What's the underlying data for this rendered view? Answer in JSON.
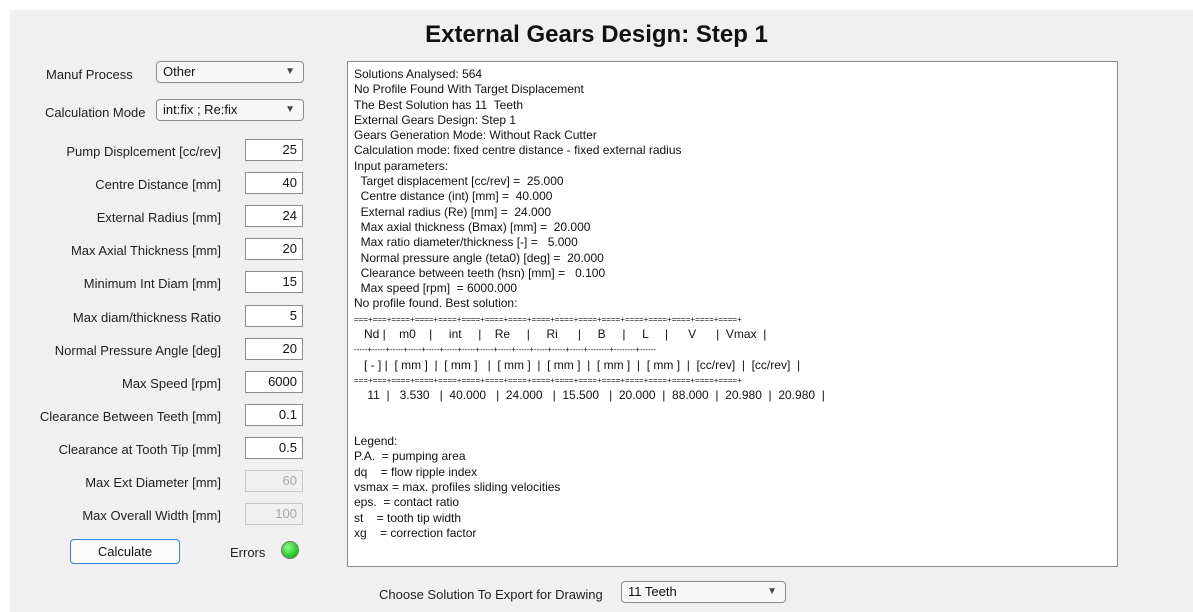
{
  "title": "External Gears Design: Step 1",
  "inputs": {
    "manuf_process": {
      "label": "Manuf Process",
      "value": "Other"
    },
    "calc_mode": {
      "label": "Calculation Mode",
      "value": "int:fix ; Re:fix"
    },
    "fields": [
      {
        "label": "Pump Displcement [cc/rev]",
        "value": "25",
        "enabled": true
      },
      {
        "label": "Centre Distance [mm]",
        "value": "40",
        "enabled": true
      },
      {
        "label": "External Radius [mm]",
        "value": "24",
        "enabled": true
      },
      {
        "label": "Max Axial Thickness [mm]",
        "value": "20",
        "enabled": true
      },
      {
        "label": "Minimum Int Diam [mm]",
        "value": "15",
        "enabled": true
      },
      {
        "label": "Max diam/thickness Ratio",
        "value": "5",
        "enabled": true
      },
      {
        "label": "Normal Pressure Angle [deg]",
        "value": "20",
        "enabled": true
      },
      {
        "label": "Max Speed [rpm]",
        "value": "6000",
        "enabled": true
      },
      {
        "label": "Clearance Between Teeth [mm]",
        "value": "0.1",
        "enabled": true
      },
      {
        "label": "Clearance at Tooth Tip [mm]",
        "value": "0.5",
        "enabled": true
      },
      {
        "label": "Max Ext Diameter [mm]",
        "value": "60",
        "enabled": false
      },
      {
        "label": "Max Overall Width [mm]",
        "value": "100",
        "enabled": false
      }
    ]
  },
  "calculate_button": "Calculate",
  "errors_label": "Errors",
  "errors_lamp_color": "#2ed02e",
  "output_lines": [
    "Solutions Analysed: 564",
    "No Profile Found With Target Displacement",
    "The Best Solution has 11  Teeth",
    "External Gears Design: Step 1",
    "Gears Generation Mode: Without Rack Cutter",
    "Calculation mode: fixed centre distance - fixed external radius",
    "Input parameters:",
    "  Target displacement [cc/rev] =  25.000",
    "  Centre distance (int) [mm] =  40.000",
    "  External radius (Re) [mm] =  24.000",
    "  Max axial thickness (Bmax) [mm] =  20.000",
    "  Max ratio diameter/thickness [-] =   5.000",
    "  Normal pressure angle (teta0) [deg] =  20.000",
    "  Clearance between teeth (hsn) [mm] =   0.100",
    "  Max speed [rpm]  = 6000.000",
    "No profile found. Best solution:",
    "===+===+====+====+====+====+====+====+====+====+====+====+====+====+====+====+====+",
    "   Nd |    m0    |     int     |    Re     |     Ri      |     B     |     L     |      V      |  Vmax  |",
    "-----+-----+-----+-----+-----+-----+-----+-----+-----+-----+-----+-----+-----+--------+--------+------",
    "   [ - ] |  [ mm ]  |  [ mm ]   |  [ mm ]  |  [ mm ]  |  [ mm ]  |  [ mm ]  |  [cc/rev]  |  [cc/rev]  |",
    "===+===+====+====+====+====+====+====+====+====+====+====+====+====+====+====+====+",
    "    11  |   3.530   |  40.000   |  24.000   |  15.500   |  20.000  |  88.000  |  20.980  |  20.980  |",
    "",
    "",
    "Legend:",
    "P.A.  = pumping area",
    "dq    = flow ripple index",
    "vsmax = max. profiles sliding velocities",
    "eps.  = contact ratio",
    "st    = tooth tip width",
    "xg    = correction factor"
  ],
  "export": {
    "label": "Choose Solution To Export for Drawing",
    "value": "11 Teeth"
  }
}
